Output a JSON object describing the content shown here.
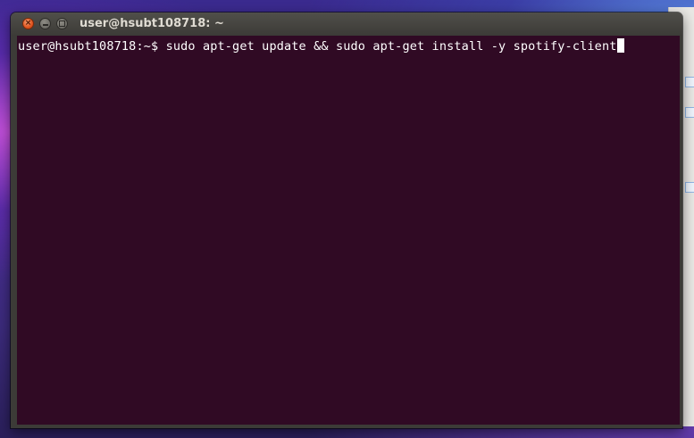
{
  "window": {
    "title": "user@hsubt108718: ~"
  },
  "terminal": {
    "prompt": "user@hsubt108718:~$",
    "command": "sudo apt-get update && sudo apt-get install -y spotify-client"
  },
  "colors": {
    "terminal_background": "#300a24",
    "terminal_text": "#ffffff",
    "titlebar": "#3c3b37",
    "close_button": "#e1541f"
  },
  "icons": {
    "close": "close-icon",
    "minimize": "minimize-icon",
    "maximize": "maximize-icon"
  }
}
